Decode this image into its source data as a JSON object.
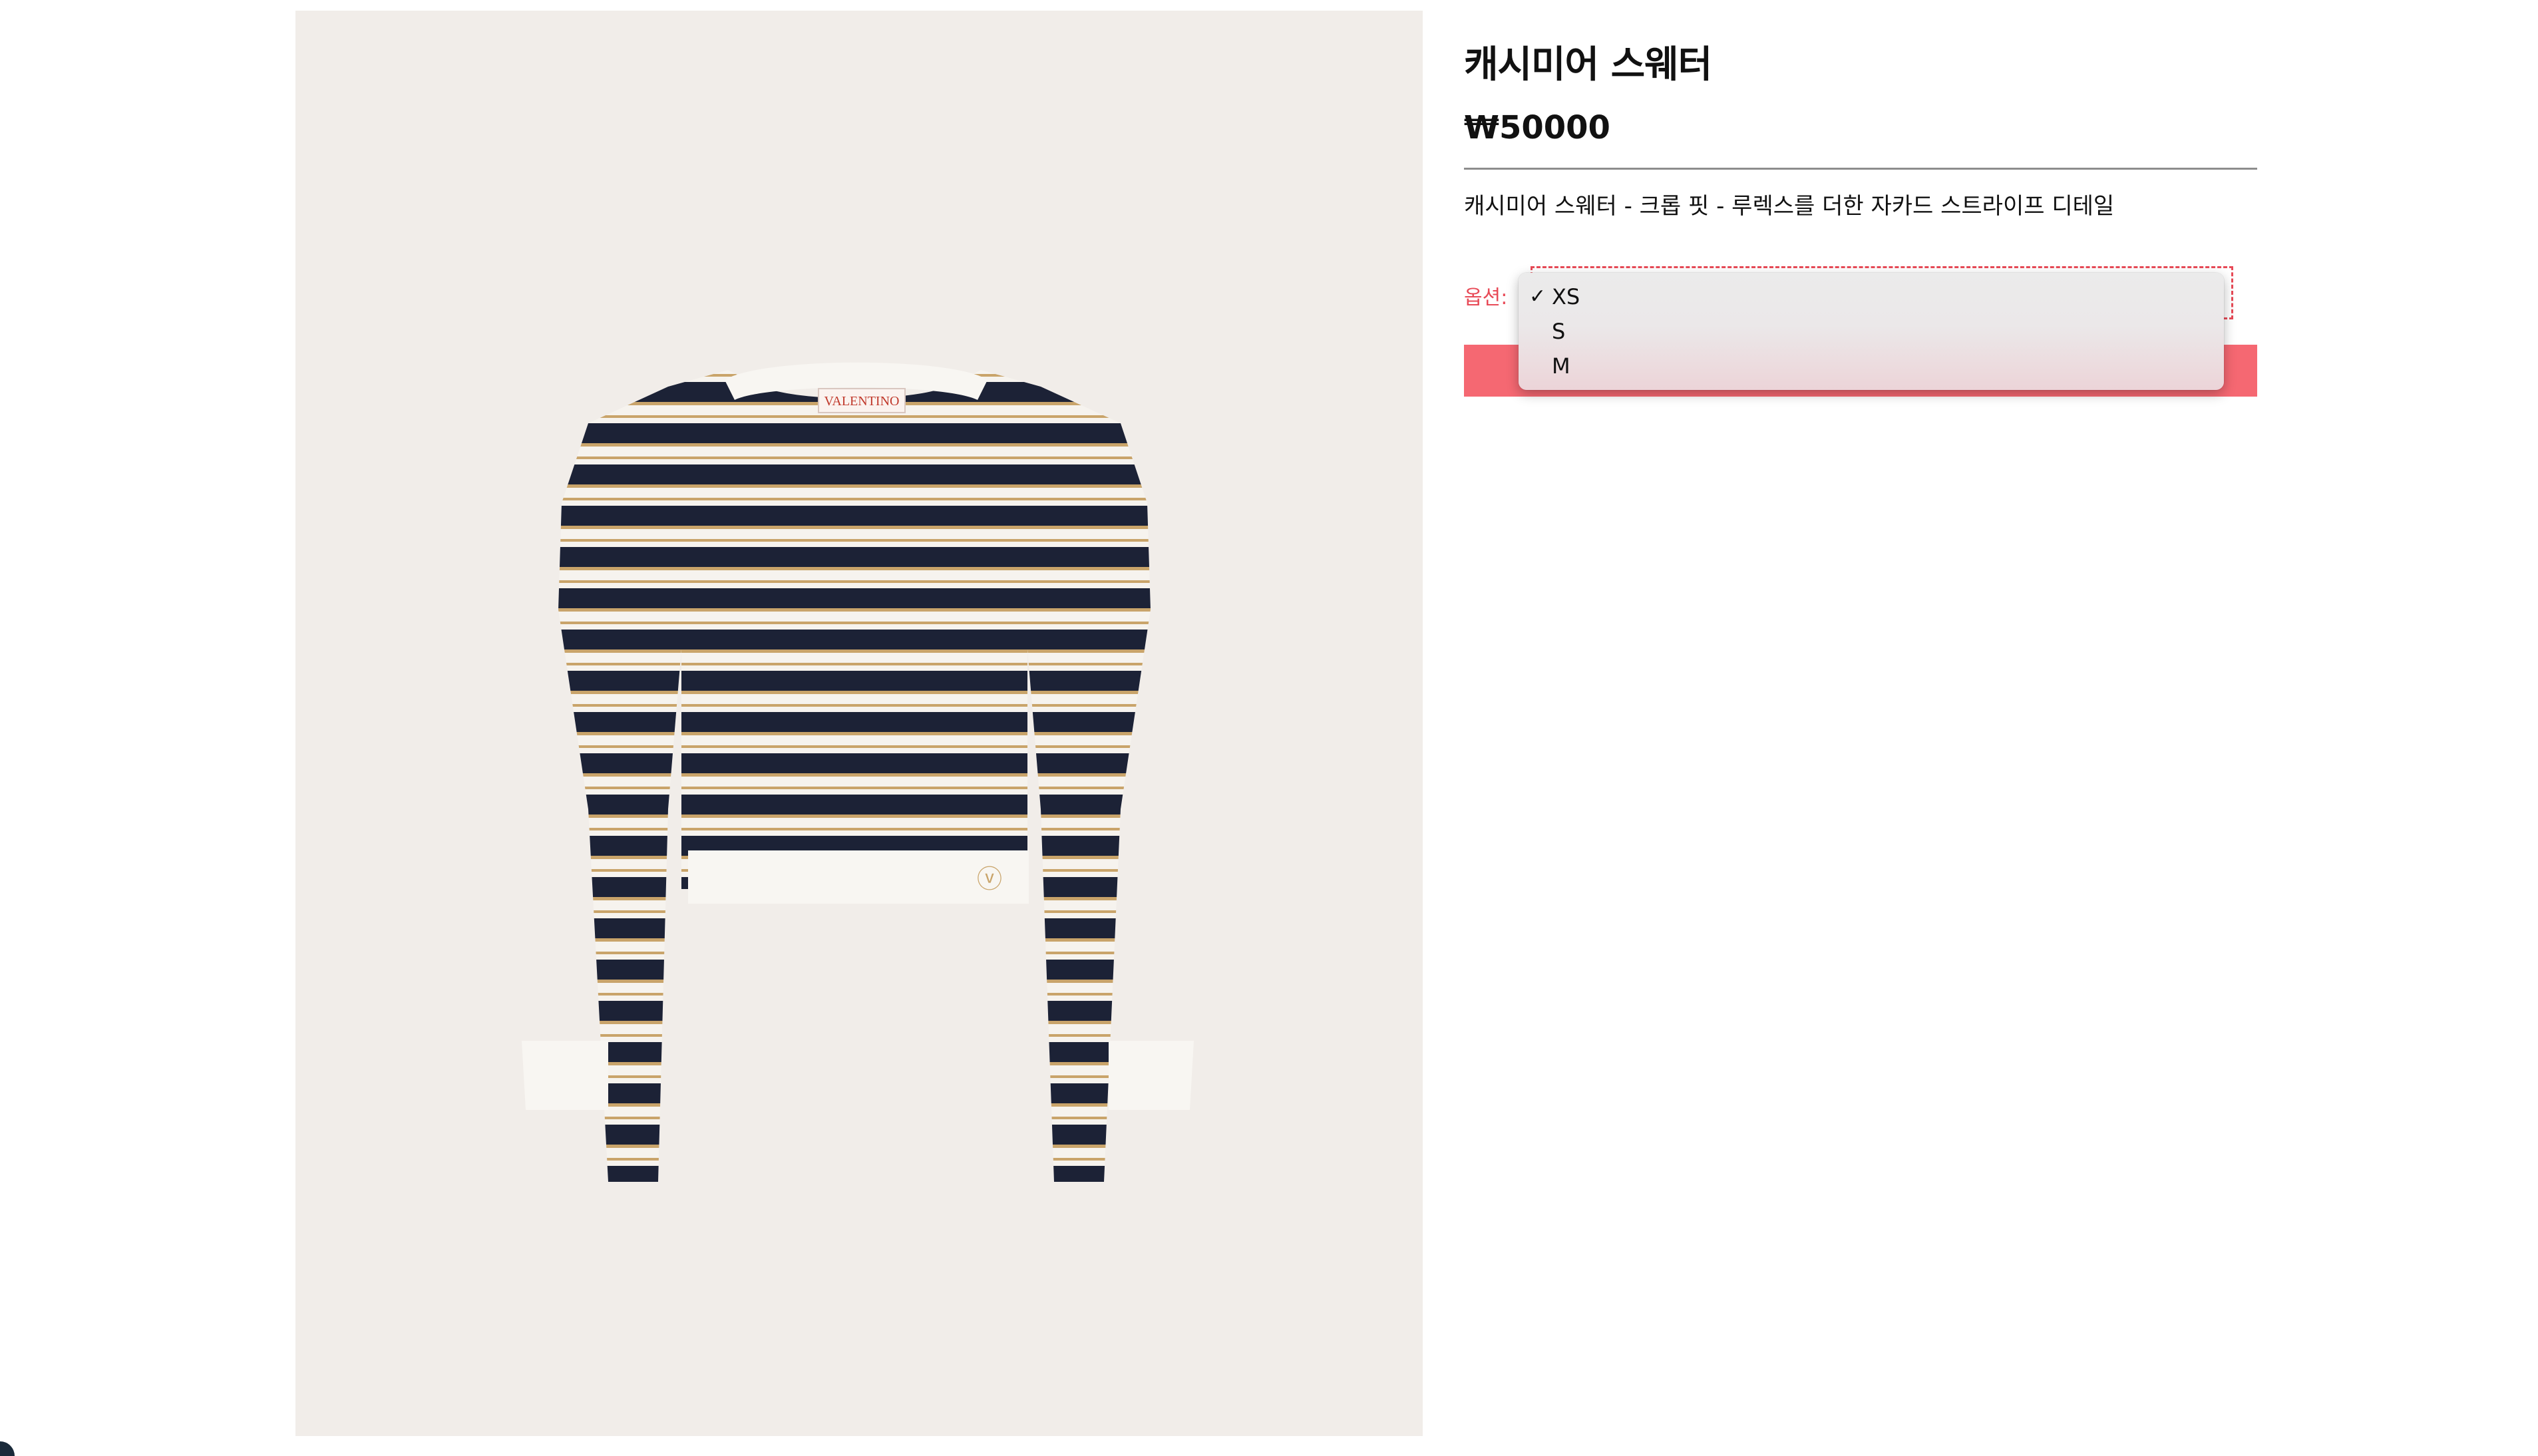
{
  "product": {
    "title": "캐시미어 스웨터",
    "price": "₩50000",
    "description": "캐시미어 스웨터 - 크롭 핏 - 루렉스를 더한 자카드 스트라이프 디테일",
    "image": {
      "brand_label": "VALENTINO",
      "logo": "VLogo"
    }
  },
  "options": {
    "label": "옵션:",
    "selected": "XS",
    "items": [
      "XS",
      "S",
      "M"
    ]
  },
  "colors": {
    "accent": "#e84a57",
    "button": "#f56872",
    "image_bg": "#f1ede9",
    "stripe_navy": "#1c2236",
    "stripe_gold": "#c9a46a"
  }
}
